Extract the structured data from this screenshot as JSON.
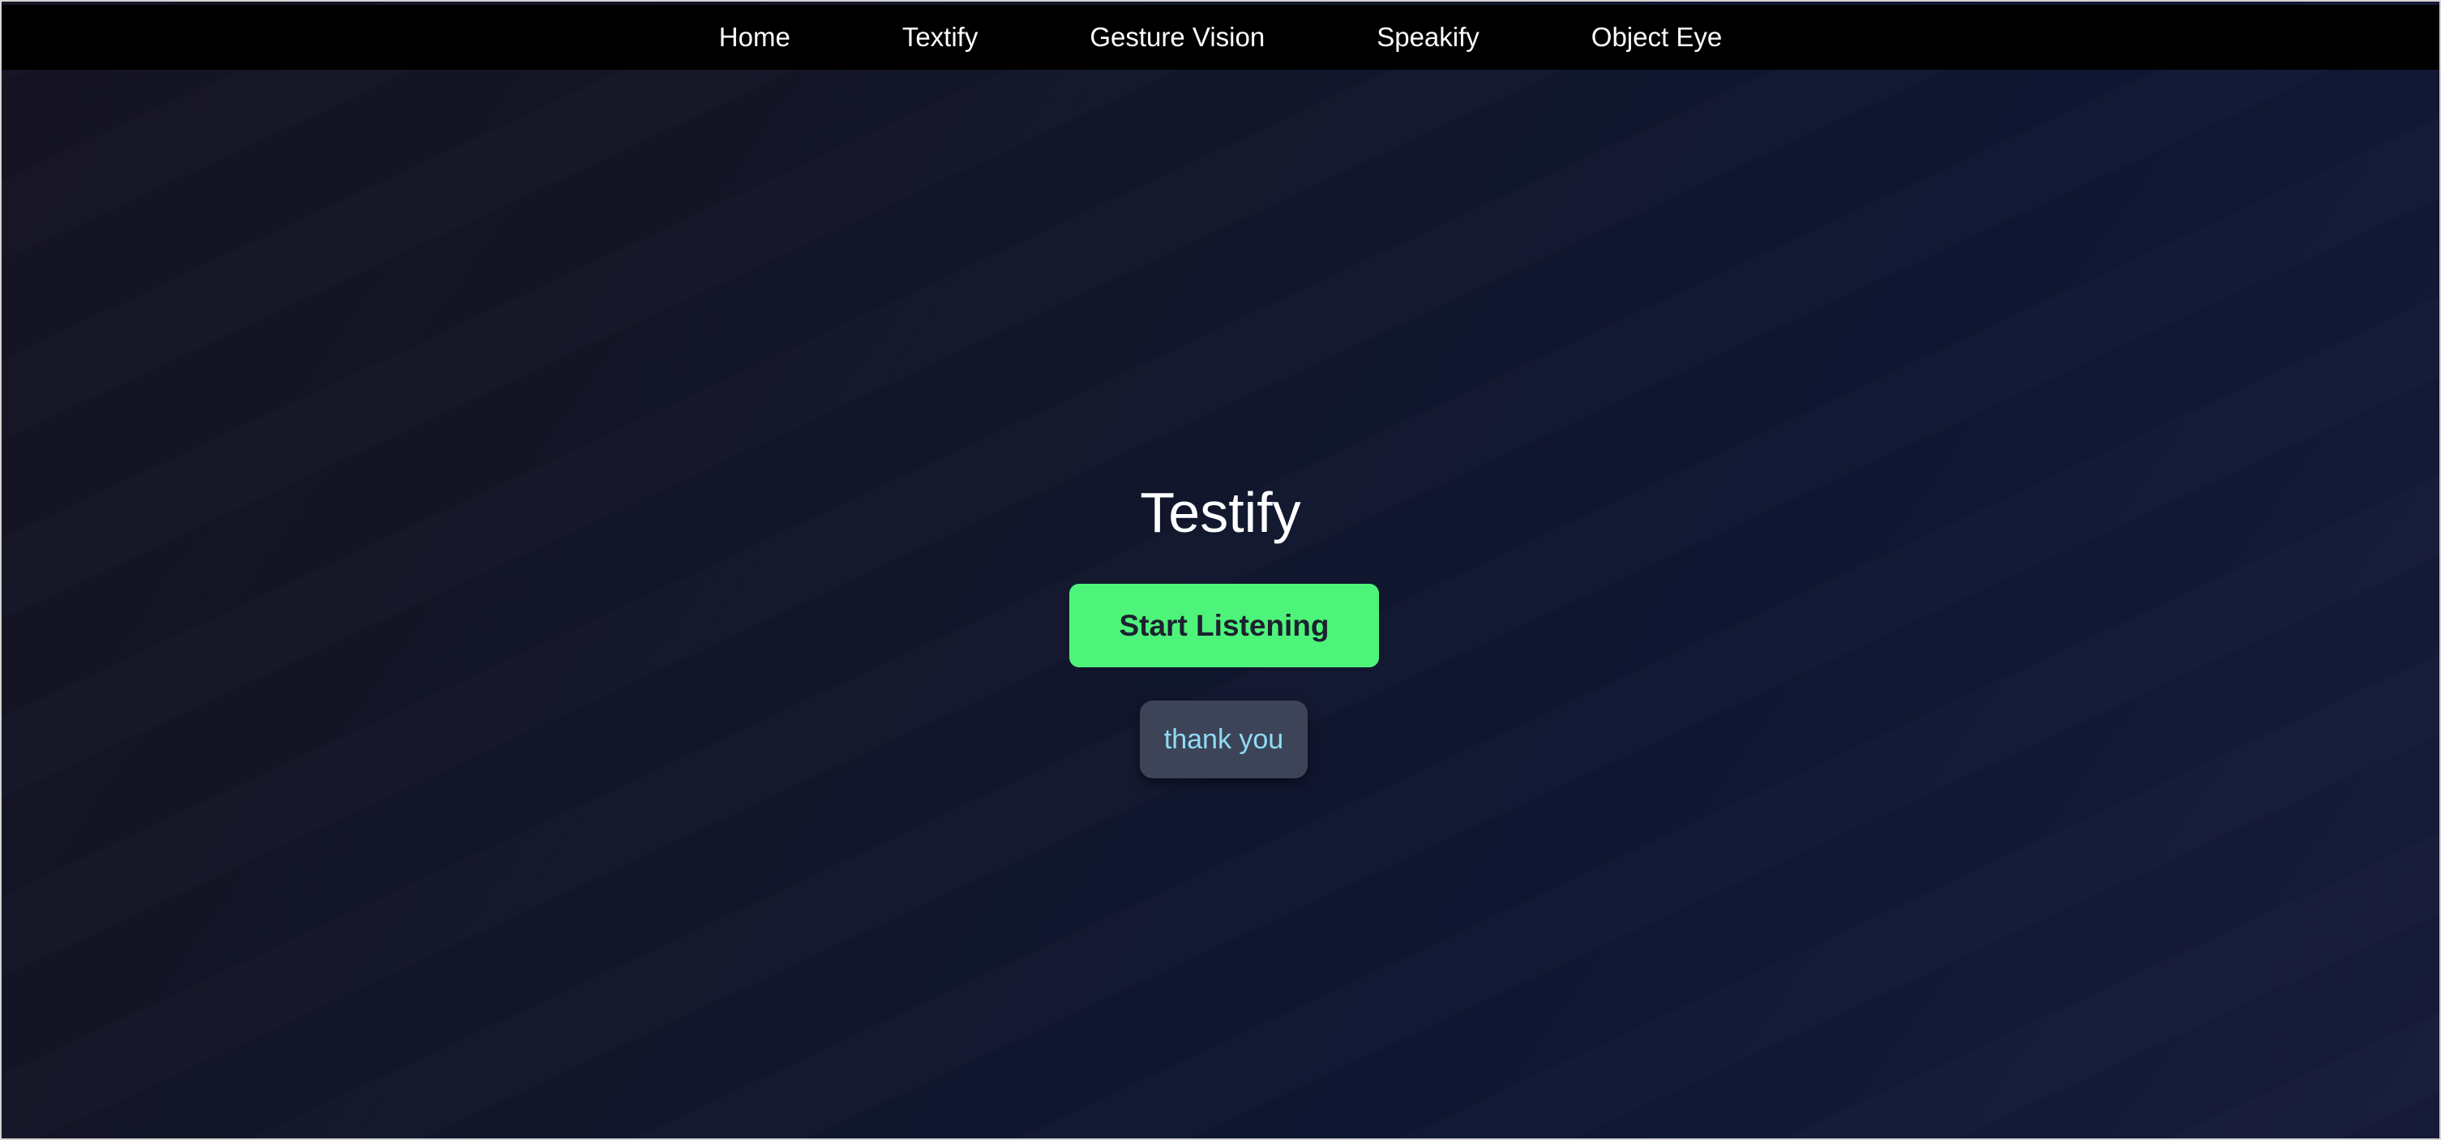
{
  "nav": {
    "items": [
      {
        "label": "Home"
      },
      {
        "label": "Textify"
      },
      {
        "label": "Gesture Vision"
      },
      {
        "label": "Speakify"
      },
      {
        "label": "Object Eye"
      }
    ]
  },
  "main": {
    "title": "Testify",
    "start_button_label": "Start Listening",
    "transcript": "thank you"
  },
  "colors": {
    "navbar_bg": "#000000",
    "button_accent": "#4ef47a",
    "transcript_bg": "#3d4457",
    "transcript_text": "#8fdcf6"
  }
}
